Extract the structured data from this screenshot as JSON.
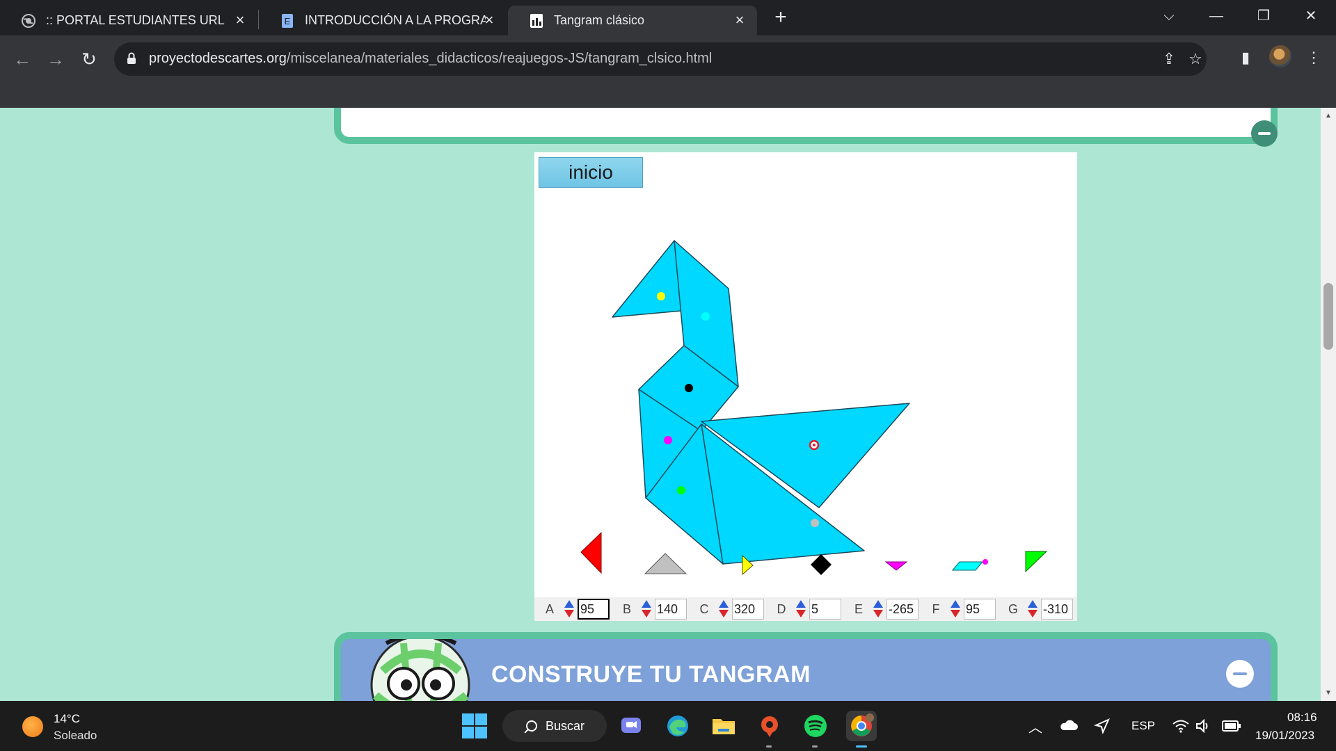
{
  "browser": {
    "tabs": [
      {
        "title": ":: PORTAL ESTUDIANTES URL ::"
      },
      {
        "title": "INTRODUCCIÓN A LA PROGRAM"
      },
      {
        "title": "Tangram clásico"
      }
    ],
    "url_host": "proyectodescartes.org",
    "url_path": "/miscelanea/materiales_didacticos/reajuegos-JS/tangram_clsico.html"
  },
  "scene": {
    "start_button": "inicio",
    "controls": [
      {
        "label": "A",
        "value": "95"
      },
      {
        "label": "B",
        "value": "140"
      },
      {
        "label": "C",
        "value": "320"
      },
      {
        "label": "D",
        "value": "5"
      },
      {
        "label": "E",
        "value": "-265"
      },
      {
        "label": "F",
        "value": "95"
      },
      {
        "label": "G",
        "value": "-310"
      }
    ],
    "colors": {
      "piece_fill": "#00d8ff",
      "piece_stroke": "#1a4a5a",
      "handle_A": "#ff0000",
      "handle_B": "#c0c0c0",
      "handle_C": "#ffff00",
      "handle_D": "#000000",
      "handle_E": "#ff00ff",
      "handle_F": "#00ffff",
      "handle_G": "#00ff00"
    }
  },
  "next_section": {
    "title": "CONSTRUYE TU TANGRAM"
  },
  "taskbar": {
    "weather_temp": "14°C",
    "weather_desc": "Soleado",
    "search_label": "Buscar",
    "language": "ESP",
    "time": "08:16",
    "date": "19/01/2023"
  }
}
